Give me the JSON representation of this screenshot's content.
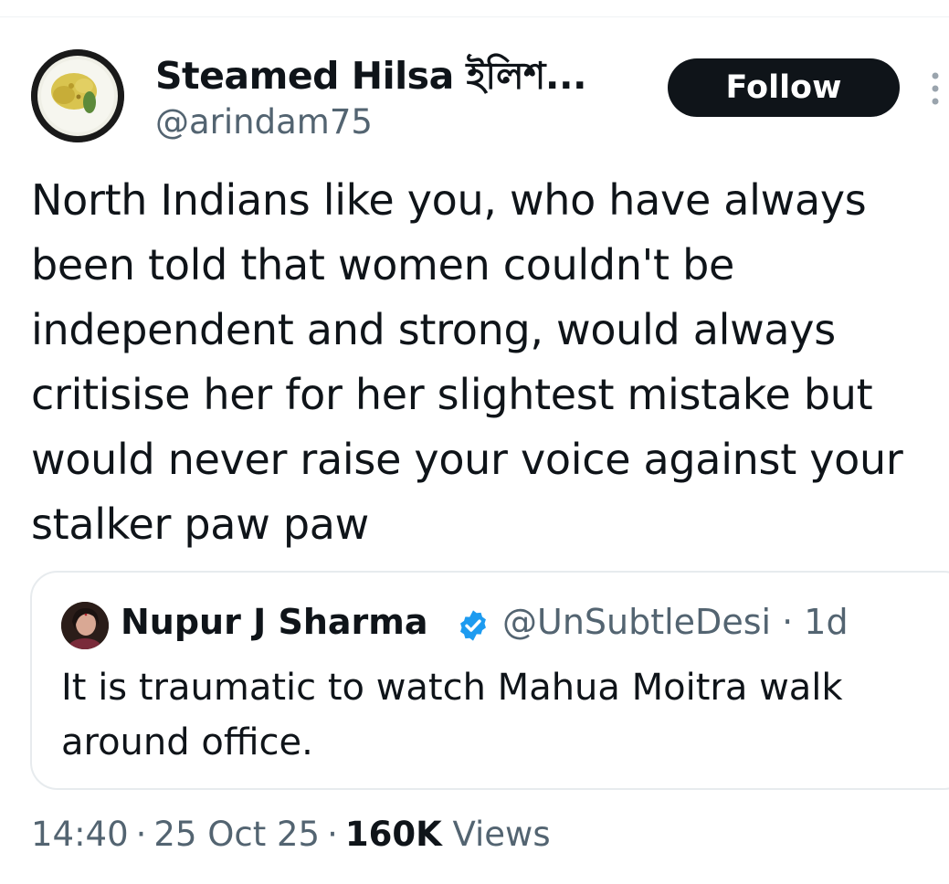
{
  "tweet": {
    "author": {
      "name": "Steamed Hilsa ইলিশ...",
      "handle": "@arindam75"
    },
    "follow_label": "Follow",
    "text": "North Indians like you, who have always been told that women couldn't be independent and strong, would always critisise her for her slightest mistake but would never raise your voice against your stalker paw paw",
    "quoted": {
      "name": "Nupur J Sharma",
      "verified": true,
      "handle_time": "@UnSubtleDesi · 1d",
      "text": "It is traumatic to watch Mahua Moitra walk around office."
    },
    "meta": {
      "time": "14:40",
      "date": "25 Oct 25",
      "views_count": "160K",
      "views_label": "Views"
    }
  },
  "colors": {
    "primary_text": "#0f1419",
    "secondary_text": "#536471",
    "verified_blue": "#1d9bf0",
    "border": "#e7ebee"
  },
  "icons": {
    "more": "more-vertical-icon",
    "verified": "verified-badge-icon"
  }
}
